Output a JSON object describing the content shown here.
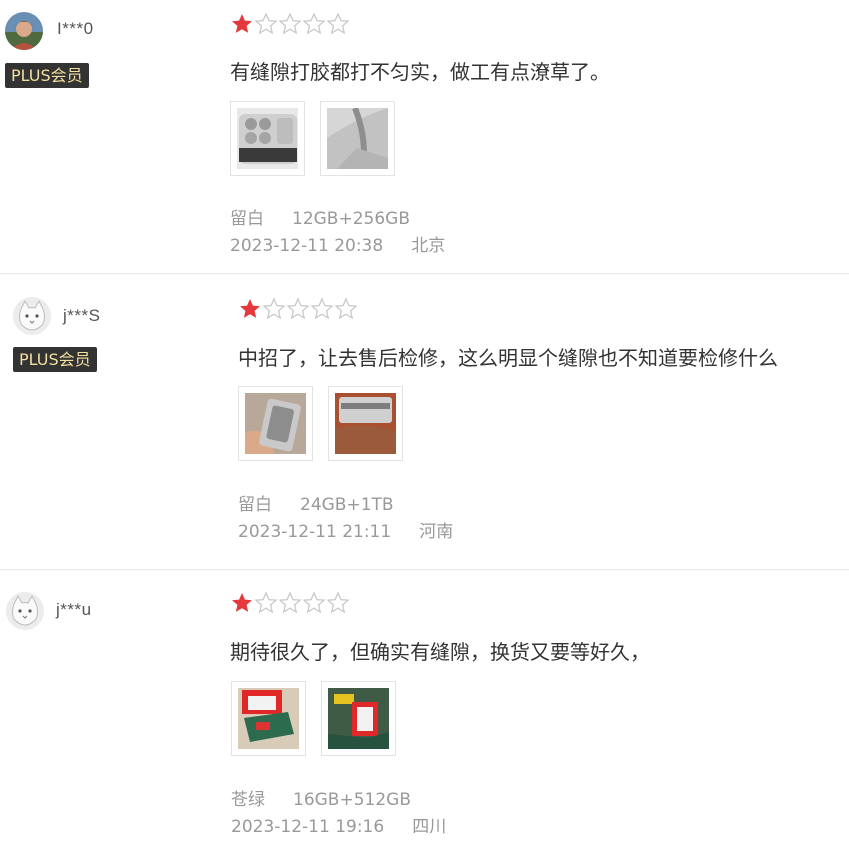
{
  "reviews": [
    {
      "username": "I***0",
      "badge": "PLUS会员",
      "rating": 1,
      "comment": "有缝隙打胶都打不匀实，做工有点潦草了。",
      "color": "留白",
      "spec": "12GB+256GB",
      "time": "2023-12-11 20:38",
      "location": "北京",
      "avatar_icon": "user-photo-avatar",
      "images": [
        "camera-module-photo",
        "phone-corner-photo"
      ]
    },
    {
      "username": "j***S",
      "badge": "PLUS会员",
      "rating": 1,
      "comment": "中招了，让去售后检修，这么明显个缝隙也不知道要检修什么",
      "color": "留白",
      "spec": "24GB+1TB",
      "time": "2023-12-11 21:11",
      "location": "河南",
      "avatar_icon": "default-cat-avatar",
      "images": [
        "phone-in-hand-photo",
        "phone-edge-gap-photo"
      ]
    },
    {
      "username": "j***u",
      "badge": "",
      "rating": 1,
      "comment": "期待很久了，但确实有缝隙，换货又要等好久，",
      "color": "苍绿",
      "spec": "16GB+512GB",
      "time": "2023-12-11 19:16",
      "location": "四川",
      "avatar_icon": "default-cat-avatar",
      "images": [
        "green-phone-red-box-photo",
        "green-phone-desk-photo"
      ]
    }
  ],
  "colors": {
    "star_filled": "#e4393c",
    "star_empty_stroke": "#c8c8c8",
    "badge_bg": "#333333",
    "badge_text": "#f3df9f",
    "meta_text": "#999999"
  }
}
